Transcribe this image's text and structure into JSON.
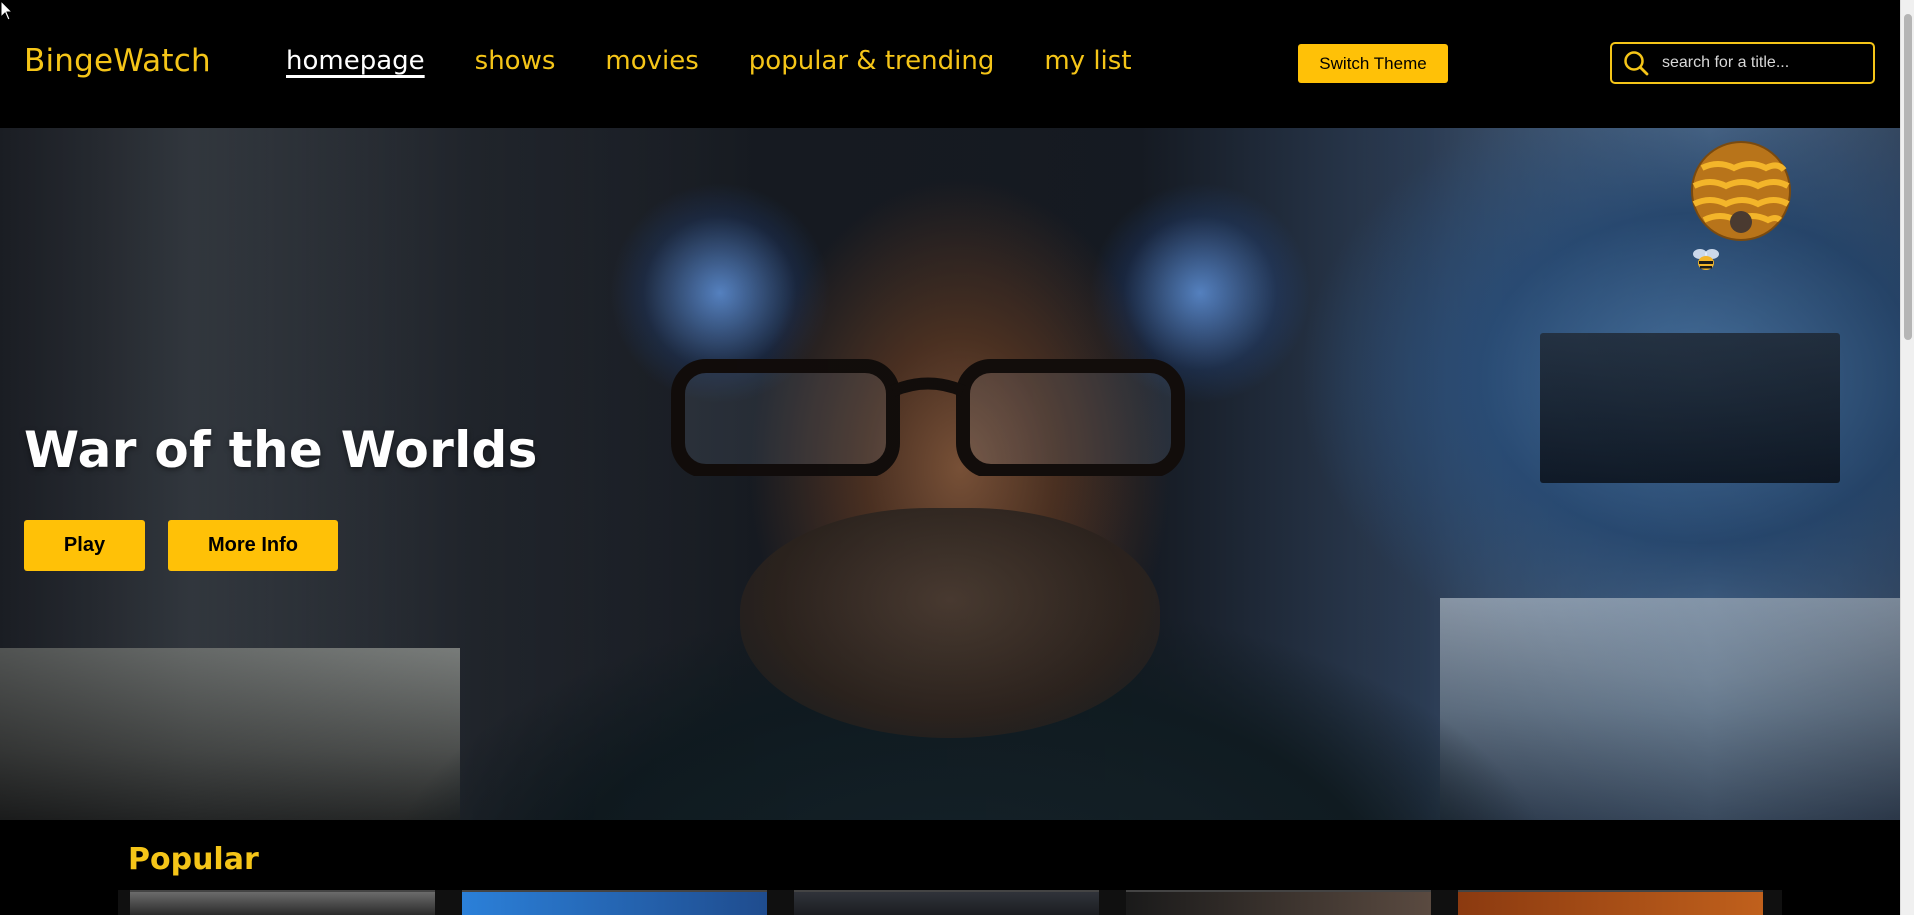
{
  "header": {
    "brand": "BingeWatch",
    "nav": [
      {
        "label": "homepage",
        "active": true
      },
      {
        "label": "shows",
        "active": false
      },
      {
        "label": "movies",
        "active": false
      },
      {
        "label": "popular & trending",
        "active": false
      },
      {
        "label": "my list",
        "active": false
      }
    ],
    "theme_button": "Switch Theme",
    "search": {
      "placeholder": "search for a title...",
      "value": "",
      "icon": "search-icon"
    }
  },
  "hero": {
    "title": "War of the Worlds",
    "play_label": "Play",
    "info_label": "More Info",
    "decor_icons": [
      "honeycomb-icon",
      "bee-icon"
    ]
  },
  "popular": {
    "title": "Popular"
  },
  "colors": {
    "accent": "#f5c518",
    "button": "#ffc107",
    "background": "#000000",
    "active_nav": "#ffffff"
  }
}
